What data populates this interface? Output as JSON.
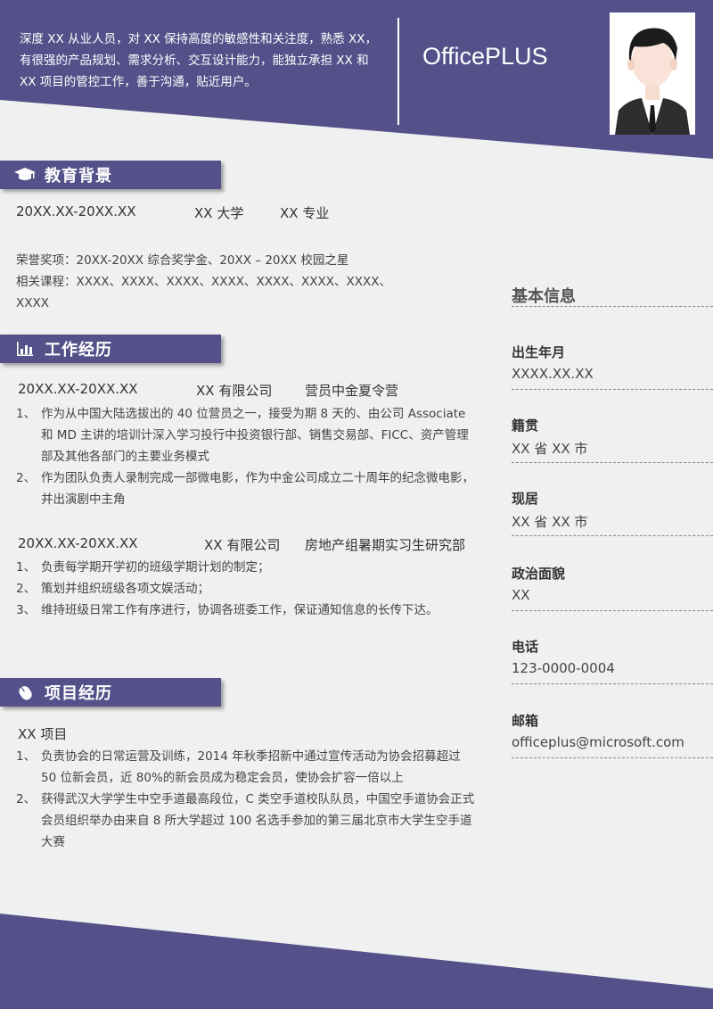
{
  "header": {
    "intro_lines": [
      "深度 XX 从业人员，对 XX 保持高度的敏感性和关注度，熟悉 XX，",
      "有很强的产品规划、需求分析、交互设计能力，能独立承担 XX 和",
      "XX 项目的管控工作，善于沟通，贴近用户。"
    ],
    "brand": "OfficePLUS"
  },
  "colors": {
    "accent": "#54508a",
    "background": "#f0f0f0"
  },
  "education": {
    "title": "教育背景",
    "icon": "graduation-cap-icon",
    "period": "20XX.XX-20XX.XX",
    "school": "XX 大学",
    "major": "XX 专业",
    "honors": "荣誉奖项：20XX-20XX  综合奖学金、20XX  –  20XX 校园之星",
    "courses_line1": "相关课程：XXXX、XXXX、XXXX、XXXX、XXXX、XXXX、XXXX、",
    "courses_line2": "XXXX"
  },
  "work": {
    "title": "工作经历",
    "icon": "bar-chart-icon",
    "jobs": [
      {
        "period": "20XX.XX-20XX.XX",
        "company": "XX 有限公司",
        "role": "营员中金夏令营",
        "items": [
          {
            "num": "1、",
            "text": "作为从中国大陆选拔出的 40 位营员之一，接受为期 8 天的、由公司 Associate 和 MD 主讲的培训计深入学习投行中投资银行部、销售交易部、FICC、资产管理部及其他各部门的主要业务模式"
          },
          {
            "num": "2、",
            "text": "作为团队负责人录制完成一部微电影，作为中金公司成立二十周年的纪念微电影，并出演剧中主角"
          }
        ]
      },
      {
        "period": "20XX.XX-20XX.XX",
        "company": "XX 有限公司",
        "role": "房地产组暑期实习生研究部",
        "items": [
          {
            "num": "1、",
            "text": "负责每学期开学初的班级学期计划的制定；"
          },
          {
            "num": "2、",
            "text": "策划并组织班级各项文娱活动；"
          },
          {
            "num": "3、",
            "text": "维持班级日常工作有序进行，协调各班委工作，保证通知信息的长传下达。"
          }
        ]
      }
    ]
  },
  "projects": {
    "title": "项目经历",
    "icon": "mouse-icon",
    "name": "XX 项目",
    "items": [
      {
        "num": "1、",
        "text": "负责协会的日常运营及训练，2014 年秋季招新中通过宣传活动为协会招募超过 50 位新会员，近 80%的新会员成为稳定会员，使协会扩容一倍以上"
      },
      {
        "num": "2、",
        "text": "获得武汉大学学生中空手道最高段位，C 类空手道校队队员，中国空手道协会正式会员组织举办由来自 8 所大学超过 100 名选手参加的第三届北京市大学生空手道大赛"
      }
    ]
  },
  "basic_info": {
    "title": "基本信息",
    "items": [
      {
        "label": "出生年月",
        "value": "XXXX.XX.XX"
      },
      {
        "label": "籍贯",
        "value": "XX 省 XX 市"
      },
      {
        "label": "现居",
        "value": "XX 省 XX 市"
      },
      {
        "label": "政治面貌",
        "value": "XX"
      },
      {
        "label": "电话",
        "value": "123-0000-0004"
      },
      {
        "label": "邮箱",
        "value": "officeplus@microsoft.com"
      }
    ]
  }
}
